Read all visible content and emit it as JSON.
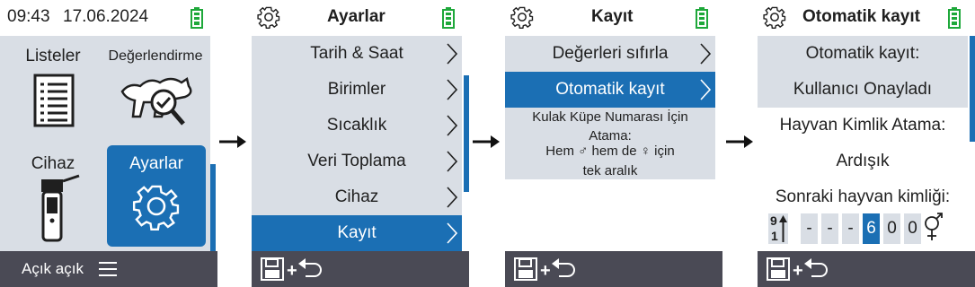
{
  "screen1": {
    "time": "09:43",
    "date": "17.06.2024",
    "tiles": {
      "listeler": "Listeler",
      "degerlendirme": "Değerlendirme",
      "cihaz": "Cihaz",
      "ayarlar": "Ayarlar"
    },
    "footer_label": "Açık açık"
  },
  "screen2": {
    "title": "Ayarlar",
    "items": [
      "Tarih & Saat",
      "Birimler",
      "Sıcaklık",
      "Veri Toplama",
      "Cihaz",
      "Kayıt"
    ],
    "selected_index": 5
  },
  "screen3": {
    "title": "Kayıt",
    "items": [
      "Değerleri sıfırla",
      "Otomatik kayıt"
    ],
    "selected_index": 1,
    "info_lines": [
      "Kulak Küpe Numarası İçin",
      "Atama:",
      "Hem ♂ hem de ♀ için",
      "tek aralık"
    ]
  },
  "screen4": {
    "title": "Otomatik kayıt",
    "auto_label": "Otomatik kayıt:",
    "auto_value": "Kullanıcı Onayladı",
    "assign_label": "Hayvan Kimlik Atama:",
    "assign_value": "Ardışık",
    "next_label": "Sonraki hayvan kimliği:",
    "sort_top": "9",
    "sort_bottom": "1",
    "id_digits": [
      "-",
      "-",
      "-",
      "6",
      "0",
      "0"
    ],
    "id_selected_index": 3
  },
  "colors": {
    "accent_blue": "#1b6fb4",
    "row_gray": "#d9dee5",
    "footer": "#4a4a55",
    "battery_green": "#1ea83a"
  },
  "icons": [
    "gear-icon",
    "battery-icon",
    "chevron-right-icon",
    "save-icon",
    "back-arrow-icon",
    "menu-icon",
    "list-document-icon",
    "livestock-search-icon",
    "device-reader-icon",
    "unisex-icon",
    "sort-order-icon",
    "arrow-right-icon"
  ]
}
